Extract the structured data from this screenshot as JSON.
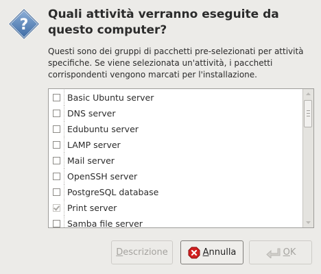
{
  "dialog": {
    "title": "Quali attività verranno eseguite da questo computer?",
    "description": "Questi sono dei gruppi di pacchetti pre-selezionati per attività specifiche. Se viene selezionata un'attività, i pacchetti corrispondenti vengono marcati per l'installazione."
  },
  "tasks": [
    {
      "label": "Basic Ubuntu server",
      "checked": false
    },
    {
      "label": "DNS server",
      "checked": false
    },
    {
      "label": "Edubuntu server",
      "checked": false
    },
    {
      "label": "LAMP server",
      "checked": false
    },
    {
      "label": "Mail server",
      "checked": false
    },
    {
      "label": "OpenSSH server",
      "checked": false
    },
    {
      "label": "PostgreSQL database",
      "checked": false
    },
    {
      "label": "Print server",
      "checked": true
    },
    {
      "label": "Samba file server",
      "checked": false
    }
  ],
  "buttons": {
    "description": {
      "first": "D",
      "rest": "escrizione",
      "enabled": false
    },
    "cancel": {
      "first": "A",
      "rest": "nnulla",
      "enabled": true
    },
    "ok": {
      "first": "O",
      "rest": "K",
      "enabled": false
    }
  },
  "colors": {
    "cancel_icon": "#d11f1f",
    "question_icon": "#2f5a8f"
  }
}
